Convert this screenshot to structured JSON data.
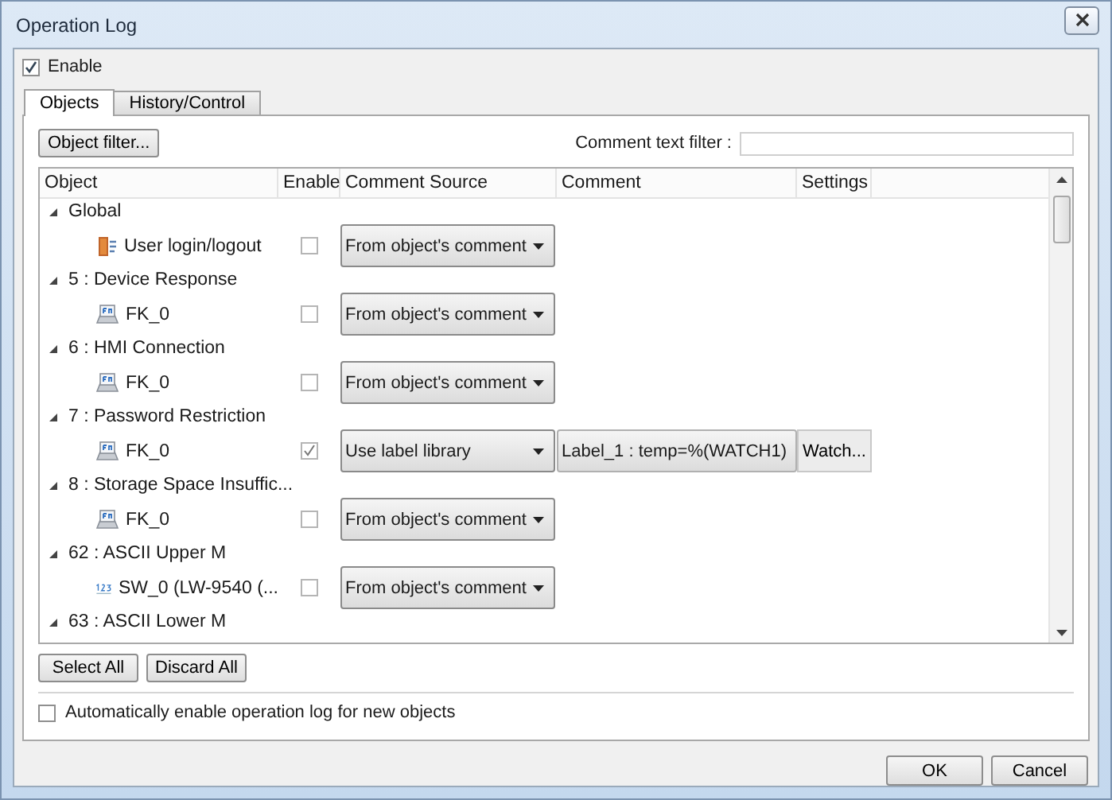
{
  "window": {
    "title": "Operation Log"
  },
  "enable": {
    "label": "Enable",
    "checked": true
  },
  "tabs": [
    {
      "label": "Objects",
      "selected": true
    },
    {
      "label": "History/Control",
      "selected": false
    }
  ],
  "object_filter_button": "Object filter...",
  "comment_filter": {
    "label": "Comment text filter :"
  },
  "table": {
    "columns": [
      "Object",
      "Enable",
      "Comment Source",
      "Comment",
      "Settings"
    ],
    "groups": [
      {
        "name": "Global",
        "expanded": true,
        "children": [
          {
            "kind": "login",
            "name": "User login/logout",
            "enabled": false,
            "comment_source": "From object's comment"
          }
        ]
      },
      {
        "name": "5 : Device Response",
        "expanded": true,
        "children": [
          {
            "kind": "function_key",
            "name": "FK_0",
            "enabled": false,
            "comment_source": "From object's comment"
          }
        ]
      },
      {
        "name": "6 : HMI Connection",
        "expanded": true,
        "children": [
          {
            "kind": "function_key",
            "name": "FK_0",
            "enabled": false,
            "comment_source": "From object's comment"
          }
        ]
      },
      {
        "name": "7 : Password Restriction",
        "expanded": true,
        "children": [
          {
            "kind": "function_key",
            "name": "FK_0",
            "enabled": true,
            "comment_source": "Use label library",
            "comment": "Label_1 : temp=%(WATCH1)",
            "settings": "Watch..."
          }
        ]
      },
      {
        "name": "8 : Storage Space Insuffic...",
        "expanded": true,
        "children": [
          {
            "kind": "function_key",
            "name": "FK_0",
            "enabled": false,
            "comment_source": "From object's comment"
          }
        ]
      },
      {
        "name": "62 : ASCII Upper M",
        "expanded": true,
        "children": [
          {
            "kind": "numeric",
            "name": "SW_0 (LW-9540 (...",
            "enabled": false,
            "comment_source": "From object's comment"
          }
        ]
      },
      {
        "name": "63 : ASCII Lower M",
        "expanded": true
      }
    ]
  },
  "table_buttons": [
    "Select All",
    "Discard All"
  ],
  "auto_enable": {
    "label": "Automatically enable operation log for new objects",
    "checked": false
  },
  "buttons": [
    "OK",
    "Cancel"
  ]
}
